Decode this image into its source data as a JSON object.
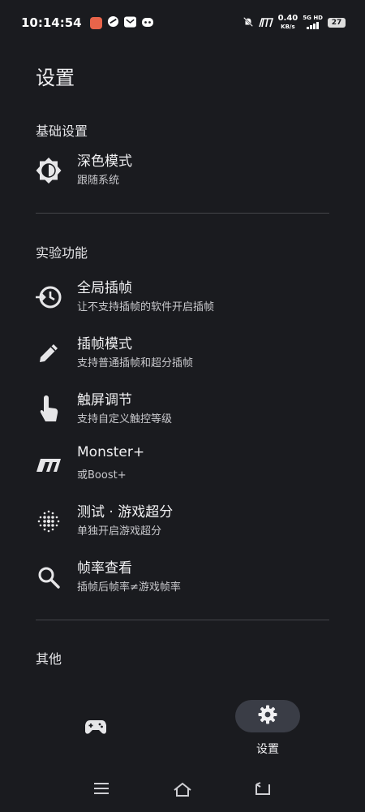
{
  "status_bar": {
    "time": "10:14:54",
    "speed_value": "0.40",
    "speed_unit": "KB/s",
    "network_top": "5G HD",
    "battery": "27"
  },
  "page": {
    "title": "设置"
  },
  "sections": {
    "basic": {
      "header": "基础设置",
      "items": [
        {
          "title": "深色模式",
          "subtitle": "跟随系统",
          "icon": "dark-mode-icon"
        }
      ]
    },
    "experimental": {
      "header": "实验功能",
      "items": [
        {
          "title": "全局插帧",
          "subtitle": "让不支持插帧的软件开启插帧",
          "icon": "global-frame-icon"
        },
        {
          "title": "插帧模式",
          "subtitle": "支持普通插帧和超分插帧",
          "icon": "pencil-icon"
        },
        {
          "title": "触屏调节",
          "subtitle": "支持自定义触控等级",
          "icon": "touch-icon"
        },
        {
          "title": "Monster+",
          "subtitle": "或Boost+",
          "icon": "monster-logo-icon"
        },
        {
          "title": "测试 · 游戏超分",
          "subtitle": "单独开启游戏超分",
          "icon": "dots-grid-icon"
        },
        {
          "title": "帧率查看",
          "subtitle": "插帧后帧率≠游戏帧率",
          "icon": "search-icon"
        }
      ]
    },
    "other": {
      "header": "其他"
    }
  },
  "bottom_nav": {
    "items": [
      {
        "label": "",
        "icon": "gamepad-icon",
        "active": false
      },
      {
        "label": "设置",
        "icon": "gear-icon",
        "active": true
      }
    ]
  },
  "colors": {
    "background": "#1a1b1f",
    "active_pill": "#3a3d46",
    "text": "#e9e9ec"
  }
}
